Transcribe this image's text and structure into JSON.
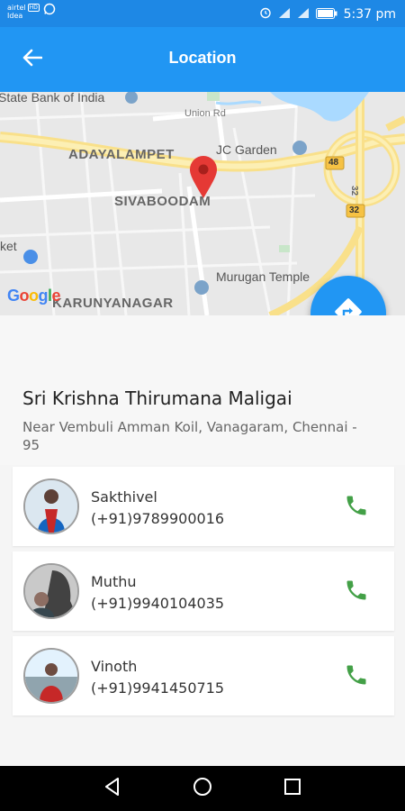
{
  "status_bar": {
    "carrier_line1": "airtel",
    "carrier_badge": "HD",
    "carrier_line2": "Idea",
    "time": "5:37 pm"
  },
  "app_bar": {
    "title": "Location",
    "back_icon": "arrow-back-icon"
  },
  "map": {
    "labels": {
      "bank": "State Bank of India",
      "union_rd": "Union Rd",
      "adayalampet": "ADAYALAMPET",
      "jc_garden": "JC Garden",
      "sivaboodam": "SIVABOODAM",
      "murugan_temple": "Murugan Temple",
      "karunyanagar": "KARUNYANAGAR",
      "market": "ket",
      "route_48": "48",
      "route_32a": "32",
      "route_32b": "32"
    },
    "google_logo": [
      "G",
      "o",
      "o",
      "g",
      "l",
      "e"
    ],
    "directions_icon": "directions-icon"
  },
  "venue": {
    "name": "Sri Krishna Thirumana Maligai",
    "address": "Near Vembuli Amman Koil, Vanagaram, Chennai - 95"
  },
  "contacts": [
    {
      "name": "Sakthivel",
      "phone": "(+91)9789900016"
    },
    {
      "name": "Muthu",
      "phone": "(+91)9940104035"
    },
    {
      "name": "Vinoth",
      "phone": "(+91)9941450715"
    }
  ],
  "colors": {
    "primary": "#2196f3",
    "status_bar": "#1e88e5",
    "call_green": "#43a047",
    "pin_red": "#e53935",
    "road_yellow": "#f9e08a"
  }
}
